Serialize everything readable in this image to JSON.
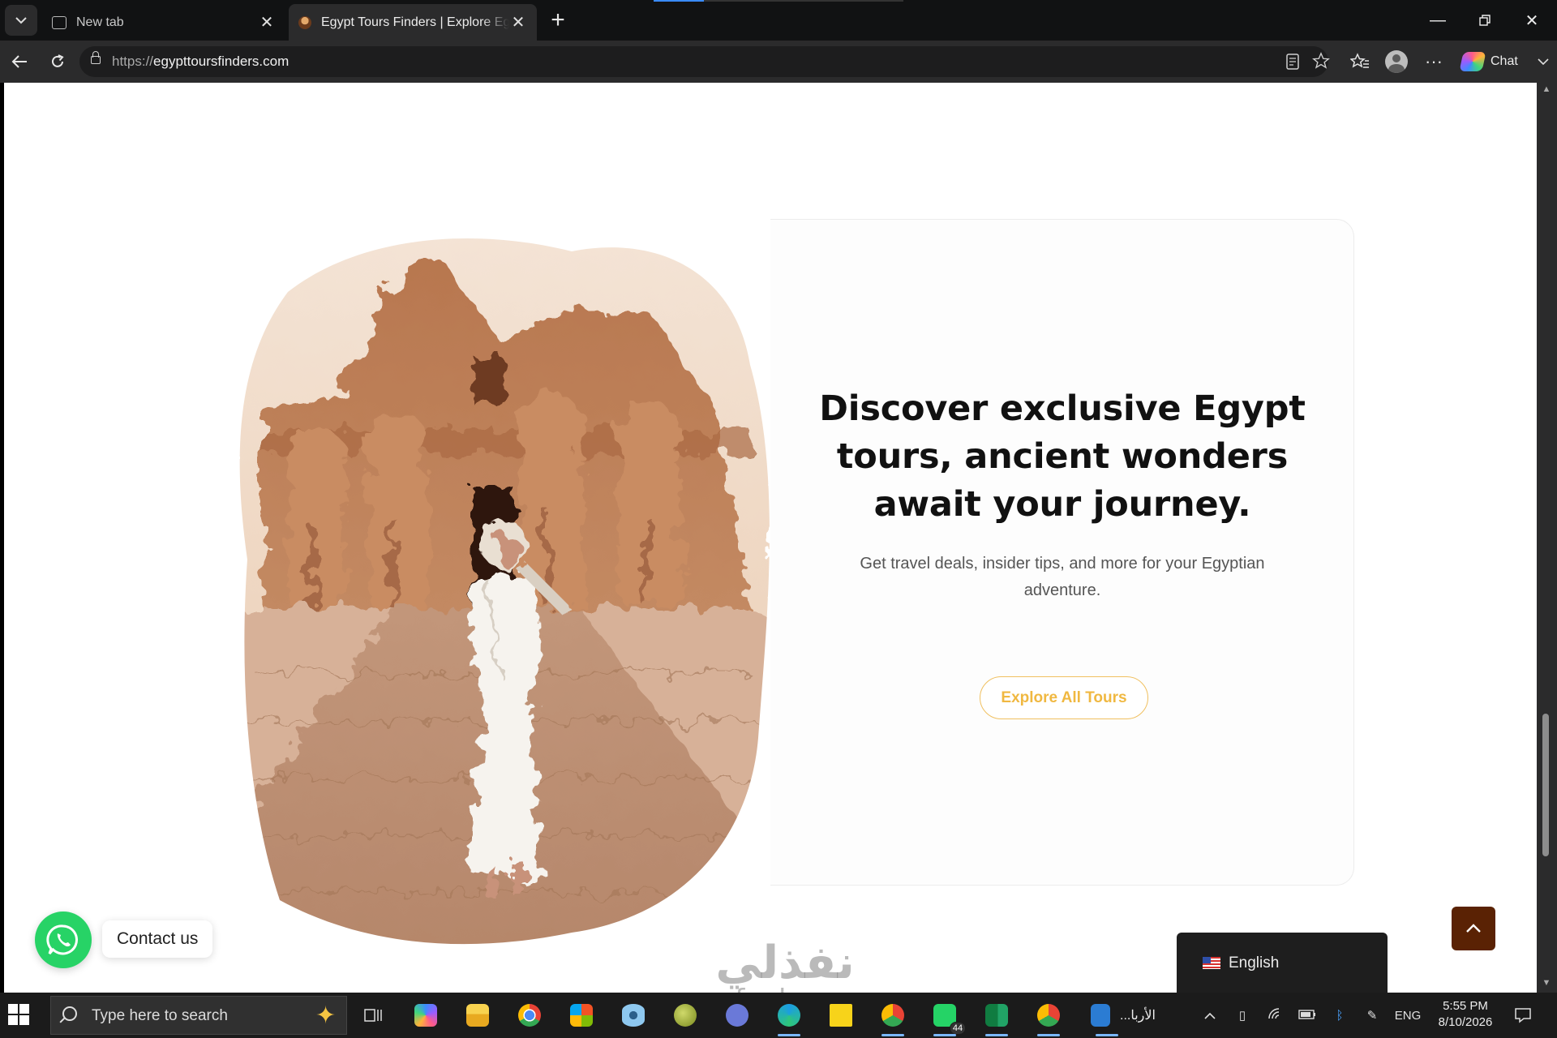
{
  "browser": {
    "tabs": [
      {
        "title": "New tab",
        "active": false,
        "icon": "new-tab-icon"
      },
      {
        "title": "Egypt Tours Finders | Explore Egypt",
        "active": true,
        "icon": "site-favicon"
      }
    ],
    "url": {
      "protocol": "https://",
      "host": "egypttoursfinders.com"
    },
    "chat_label": "Chat"
  },
  "page": {
    "hero": {
      "headline": "Discover exclusive Egypt tours, ancient wonders await your journey.",
      "subline": "Get travel deals, insider tips, and more for your Egyptian adventure.",
      "cta_label": "Explore All Tours",
      "image": "abu-simbel-temple-traveler-photo"
    },
    "whatsapp": {
      "label": "Contact us"
    },
    "language": {
      "label": "English",
      "flag": "us-flag-icon"
    },
    "watermark": {
      "arabic": "نفذلي",
      "latin": "nafezly.com"
    },
    "accent_colors": {
      "cta": "#f0b841",
      "totop": "#5a2204",
      "whatsapp": "#27d366"
    }
  },
  "taskbar": {
    "search_placeholder": "Type here to search",
    "arabic_item": "...الأربا",
    "whatsapp_badge": "44",
    "lang": "ENG",
    "time": "5:55 PM",
    "date": "8/10/2026"
  }
}
